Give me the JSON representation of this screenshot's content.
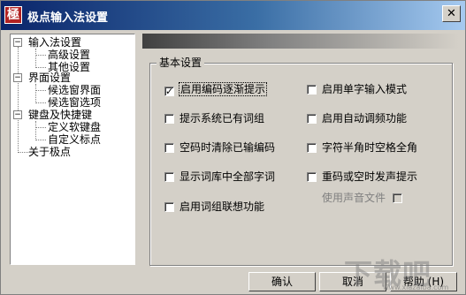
{
  "window": {
    "title": "极点输入法设置",
    "icon_glyph": "極",
    "close_glyph": "✕"
  },
  "tree": [
    {
      "label": "输入法设置",
      "expanded": true
    },
    {
      "label": "高级设置"
    },
    {
      "label": "其他设置"
    },
    {
      "label": "界面设置",
      "expanded": true
    },
    {
      "label": "候选窗界面"
    },
    {
      "label": "候选窗选项"
    },
    {
      "label": "键盘及快捷键",
      "expanded": true
    },
    {
      "label": "定义软键盘"
    },
    {
      "label": "自定义标点"
    },
    {
      "label": "关于极点"
    }
  ],
  "group": {
    "label": "基本设置",
    "left_options": [
      {
        "label": "启用编码逐渐提示",
        "checked": true
      },
      {
        "label": "提示系统已有词组",
        "checked": false
      },
      {
        "label": "空码时清除已输编码",
        "checked": false
      },
      {
        "label": "显示词库中全部字词",
        "checked": false
      },
      {
        "label": "启用词组联想功能",
        "checked": false
      }
    ],
    "right_options": [
      {
        "label": "启用单字输入模式",
        "checked": false
      },
      {
        "label": "启用自动调频功能",
        "checked": false
      },
      {
        "label": "字符半角时空格全角",
        "checked": false
      },
      {
        "label": "重码或空时发声提示",
        "checked": false
      }
    ],
    "sound_file_label": "使用声音文件"
  },
  "buttons": {
    "ok": "确认",
    "cancel": "取消",
    "help": "帮助 (H)"
  },
  "watermark": {
    "text": "下载吧",
    "url": "www.xiazaiba.com"
  }
}
